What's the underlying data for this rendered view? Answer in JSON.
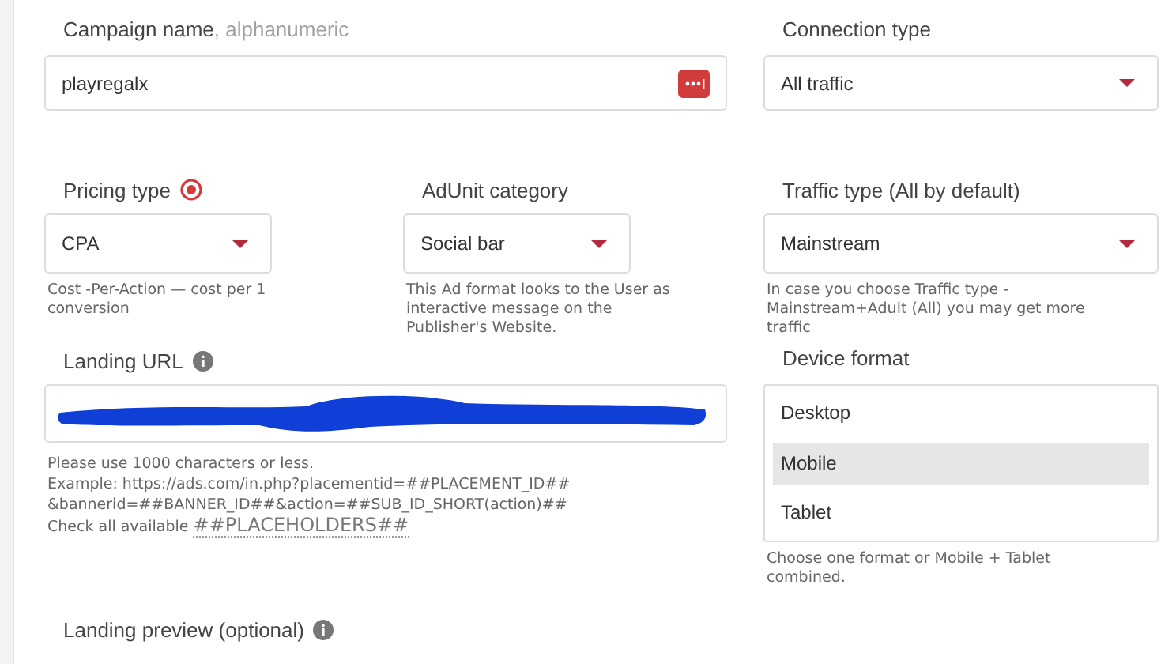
{
  "campaign_name": {
    "label": "Campaign name",
    "hint": ", alphanumeric",
    "value": "playregalx"
  },
  "connection_type": {
    "label": "Connection type",
    "value": "All traffic"
  },
  "pricing_type": {
    "label": "Pricing type",
    "value": "CPA",
    "help": "Cost -Per-Action — cost per 1 conversion"
  },
  "adunit_category": {
    "label": "AdUnit category",
    "value": "Social bar",
    "help": "This Ad format looks to the User as interactive message on the Publisher's Website."
  },
  "traffic_type": {
    "label": "Traffic type (All by default)",
    "value": "Mainstream",
    "help": "In case you choose Traffic type - Mainstream+Adult (All) you may get more traffic"
  },
  "landing_url": {
    "label": "Landing URL",
    "redacted": true,
    "help_lines": [
      "Please use 1000 characters or less.",
      "Example: https://ads.com/in.php?placementid=##PLACEMENT_ID##",
      "&bannerid=##BANNER_ID##&action=##SUB_ID_SHORT(action)##"
    ],
    "check_text": "Check all available",
    "placeholders_link": "##PLACEHOLDERS##"
  },
  "device_format": {
    "label": "Device format",
    "options": [
      {
        "label": "Desktop",
        "selected": false
      },
      {
        "label": "Mobile",
        "selected": true
      },
      {
        "label": "Tablet",
        "selected": false
      }
    ],
    "help": "Choose one format or Mobile + Tablet combined."
  },
  "landing_preview": {
    "label": "Landing preview (optional)"
  }
}
